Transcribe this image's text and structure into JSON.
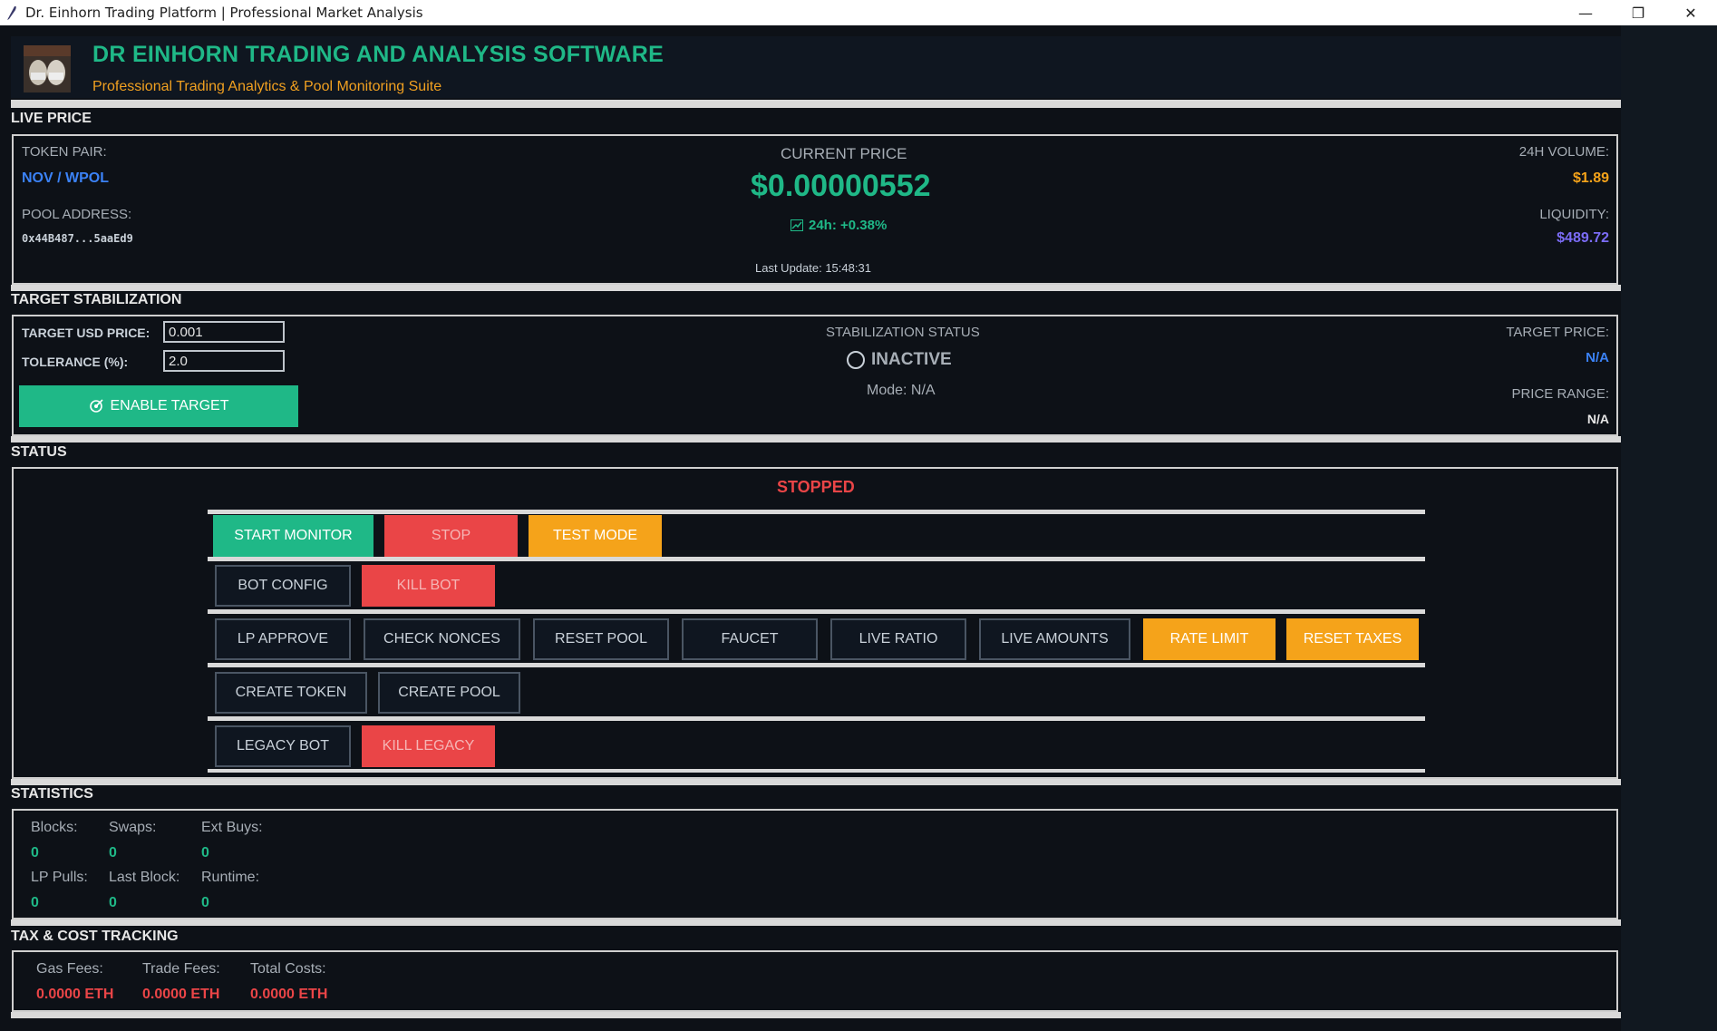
{
  "window": {
    "title": "Dr. Einhorn Trading Platform | Professional Market Analysis",
    "controls": [
      "minimize",
      "restore",
      "close"
    ]
  },
  "header": {
    "title": "DR EINHORN TRADING AND ANALYSIS SOFTWARE",
    "subtitle": "Professional Trading Analytics & Pool Monitoring Suite"
  },
  "live_price": {
    "section": "LIVE PRICE",
    "token_pair_label": "TOKEN PAIR:",
    "token_pair": "NOV / WPOL",
    "pool_address_label": "POOL ADDRESS:",
    "pool_address": "0x44B487...5aaEd9",
    "current_price_label": "CURRENT PRICE",
    "current_price": "$0.00000552",
    "change": "24h: +0.38%",
    "last_update": "Last Update: 15:48:31",
    "volume_label": "24H VOLUME:",
    "volume": "$1.89",
    "liquidity_label": "LIQUIDITY:",
    "liquidity": "$489.72"
  },
  "target": {
    "section": "TARGET STABILIZATION",
    "usd_price_label": "TARGET USD PRICE:",
    "usd_price_value": "0.001",
    "tolerance_label": "TOLERANCE (%):",
    "tolerance_value": "2.0",
    "enable_button": "ENABLE TARGET",
    "status_label": "STABILIZATION STATUS",
    "status": "INACTIVE",
    "mode": "Mode: N/A",
    "target_price_label": "TARGET PRICE:",
    "target_price": "N/A",
    "price_range_label": "PRICE RANGE:",
    "price_range": "N/A"
  },
  "status": {
    "section": "STATUS",
    "state": "STOPPED",
    "buttons": {
      "start_monitor": "START MONITOR",
      "stop": "STOP",
      "test_mode": "TEST MODE",
      "bot_config": "BOT CONFIG",
      "kill_bot": "KILL BOT",
      "lp_approve": "LP APPROVE",
      "check_nonces": "CHECK NONCES",
      "reset_pool": "RESET POOL",
      "faucet": "FAUCET",
      "live_ratio": "LIVE RATIO",
      "live_amounts": "LIVE AMOUNTS",
      "rate_limit": "RATE LIMIT",
      "reset_taxes": "RESET TAXES",
      "create_token": "CREATE TOKEN",
      "create_pool": "CREATE POOL",
      "legacy_bot": "LEGACY BOT",
      "kill_legacy": "KILL LEGACY"
    }
  },
  "statistics": {
    "section": "STATISTICS",
    "items": [
      {
        "label": "Blocks:",
        "value": "0"
      },
      {
        "label": "Swaps:",
        "value": "0"
      },
      {
        "label": "Ext Buys:",
        "value": "0"
      },
      {
        "label": "LP Pulls:",
        "value": "0"
      },
      {
        "label": "Last Block:",
        "value": "0"
      },
      {
        "label": "Runtime:",
        "value": "0"
      }
    ]
  },
  "costs": {
    "section": "TAX & COST TRACKING",
    "items": [
      {
        "label": "Gas Fees:",
        "value": "0.0000 ETH"
      },
      {
        "label": "Trade Fees:",
        "value": "0.0000 ETH"
      },
      {
        "label": "Total Costs:",
        "value": "0.0000 ETH"
      }
    ]
  },
  "colors": {
    "accent_green": "#1fb887",
    "accent_orange": "#f5a31a",
    "alert_red": "#ea4547",
    "link_blue": "#3b82f6",
    "liquidity_purple": "#7b6cf6"
  }
}
